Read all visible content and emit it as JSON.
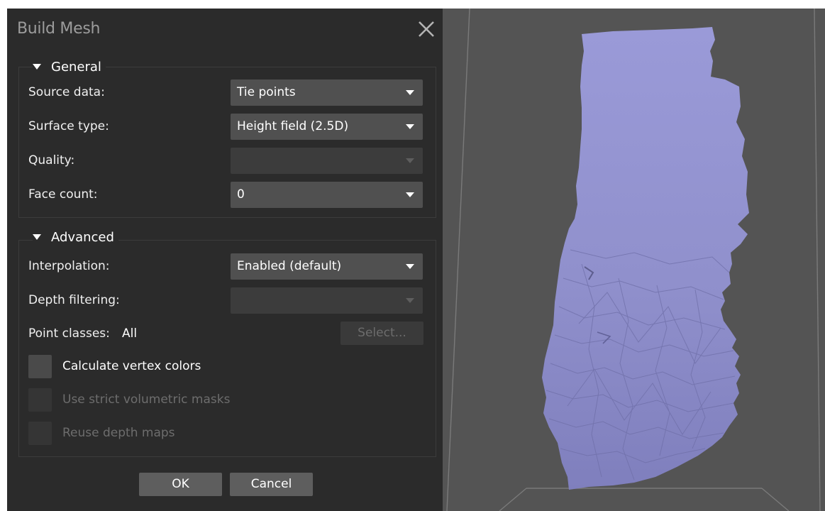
{
  "dialog": {
    "title": "Build Mesh",
    "close_icon": "close-icon",
    "general": {
      "title": "General",
      "source_data": {
        "label": "Source data:",
        "value": "Tie points"
      },
      "surface_type": {
        "label": "Surface type:",
        "value": "Height field (2.5D)"
      },
      "quality": {
        "label": "Quality:",
        "value": ""
      },
      "face_count": {
        "label": "Face count:",
        "value": "0"
      }
    },
    "advanced": {
      "title": "Advanced",
      "interpolation": {
        "label": "Interpolation:",
        "value": "Enabled (default)"
      },
      "depth_filtering": {
        "label": "Depth filtering:",
        "value": ""
      },
      "point_classes": {
        "label": "Point classes:",
        "value": "All",
        "select_label": "Select..."
      },
      "calculate_vertex_colors": {
        "label": "Calculate vertex colors",
        "checked": false,
        "enabled": true
      },
      "strict_volumetric_masks": {
        "label": "Use strict volumetric masks",
        "checked": false,
        "enabled": false
      },
      "reuse_depth_maps": {
        "label": "Reuse depth maps",
        "checked": false,
        "enabled": false
      }
    },
    "ok_label": "OK",
    "cancel_label": "Cancel"
  },
  "viewport": {
    "mesh_color": "#9a9ad8",
    "background_color": "#545454"
  }
}
